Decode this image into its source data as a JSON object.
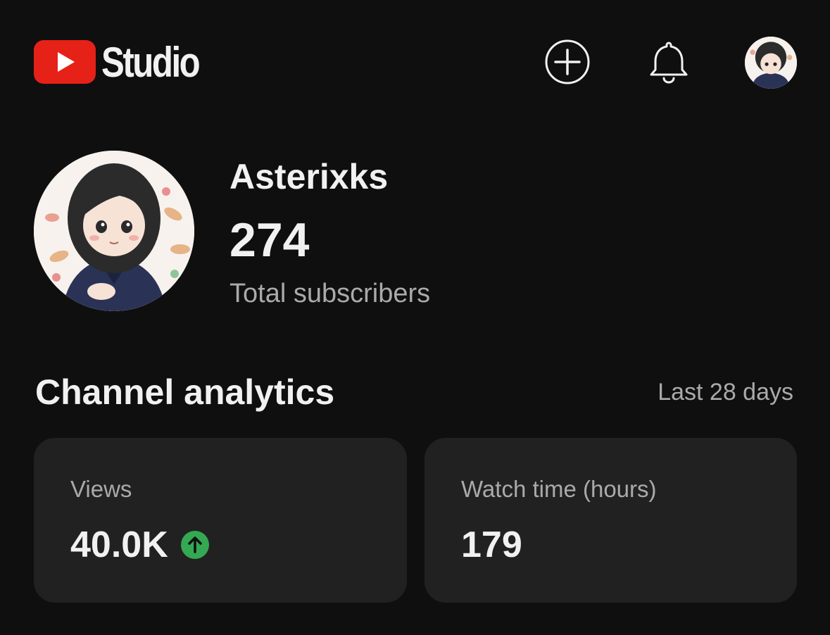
{
  "header": {
    "logo_text": "Studio",
    "icons": {
      "create": "create-plus-icon",
      "notifications": "bell-icon",
      "account": "account-avatar"
    },
    "brand_color": "#e62117"
  },
  "channel": {
    "name": "Asterixks",
    "subscriber_count": "274",
    "subscriber_label": "Total subscribers"
  },
  "analytics": {
    "title": "Channel analytics",
    "period": "Last 28 days",
    "cards": [
      {
        "label": "Views",
        "value": "40.0K",
        "trend": "up",
        "trend_color": "#34a853"
      },
      {
        "label": "Watch time (hours)",
        "value": "179"
      }
    ]
  }
}
